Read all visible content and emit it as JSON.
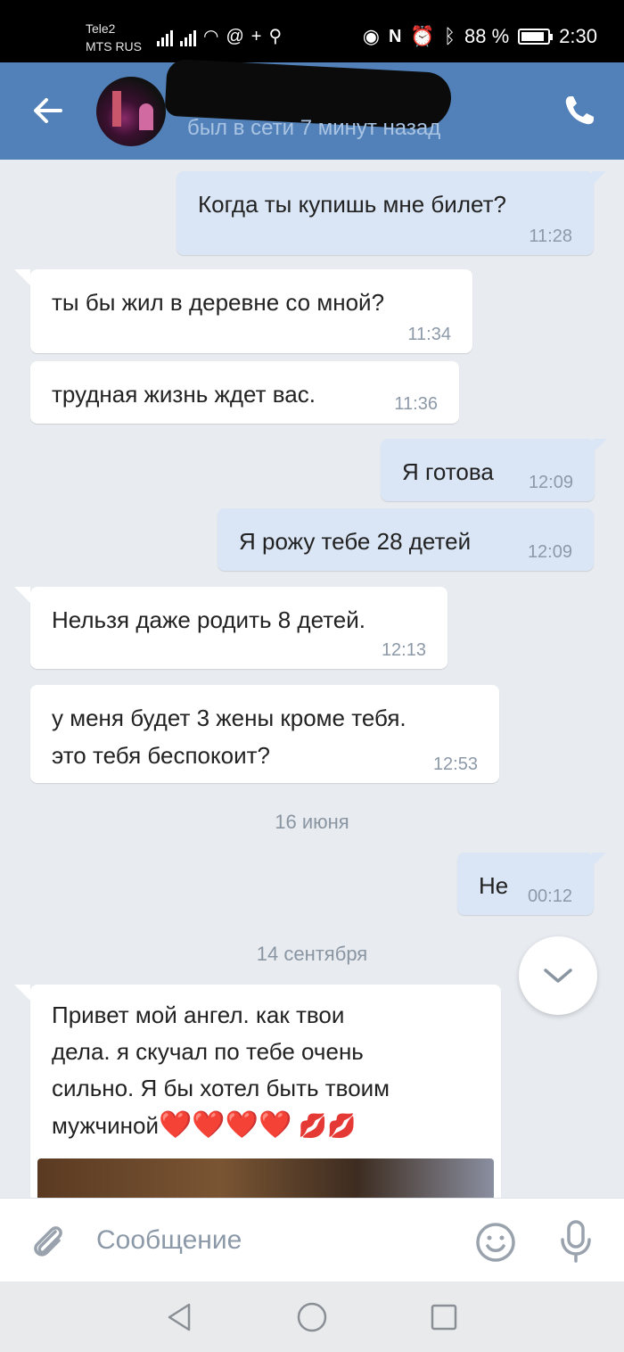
{
  "status_bar": {
    "carrier_1": "Tele2",
    "carrier_2": "MTS RUS",
    "battery": "88 %",
    "battery_level": 0.88,
    "time": "2:30"
  },
  "header": {
    "contact_status": "был в сети 7 минут назад",
    "icons": [
      "arrow-left-icon",
      "phone-icon"
    ]
  },
  "messages": [
    {
      "dir": "out",
      "text": "Когда ты купишь мне билет?",
      "time": "11:28"
    },
    {
      "dir": "in",
      "text": "ты бы жил в деревне со мной?",
      "time": "11:34"
    },
    {
      "dir": "in",
      "text": "трудная жизнь ждет вас.",
      "time": "11:36"
    },
    {
      "dir": "out",
      "text": "Я готова",
      "time": "12:09"
    },
    {
      "dir": "out",
      "text": "Я рожу тебе 28 детей",
      "time": "12:09"
    },
    {
      "dir": "in",
      "text": "Нельзя даже родить 8 детей.",
      "time": "12:13"
    },
    {
      "dir": "in",
      "text": "у меня будет 3 жены кроме тебя.\nэто тебя беспокоит?",
      "time": "12:53"
    },
    {
      "dir": "out",
      "text": "Не",
      "time": "00:12"
    },
    {
      "dir": "in",
      "text": "Привет мой ангел. как твои\nдела. я скучал по тебе очень\nсильно. Я бы хотел быть твоим\nмужчиной"
    }
  ],
  "dates": [
    "16 июня",
    "14 сентября"
  ],
  "emoji_tail": {
    "hearts": "❤️❤️❤️❤️",
    "kisses": "💋💋"
  },
  "composer": {
    "placeholder": "Сообщение"
  },
  "colors": {
    "header": "#5181b8",
    "outgoing_bubble": "#dae6f5",
    "incoming_bubble": "#ffffff",
    "background": "#e8ecf1"
  }
}
